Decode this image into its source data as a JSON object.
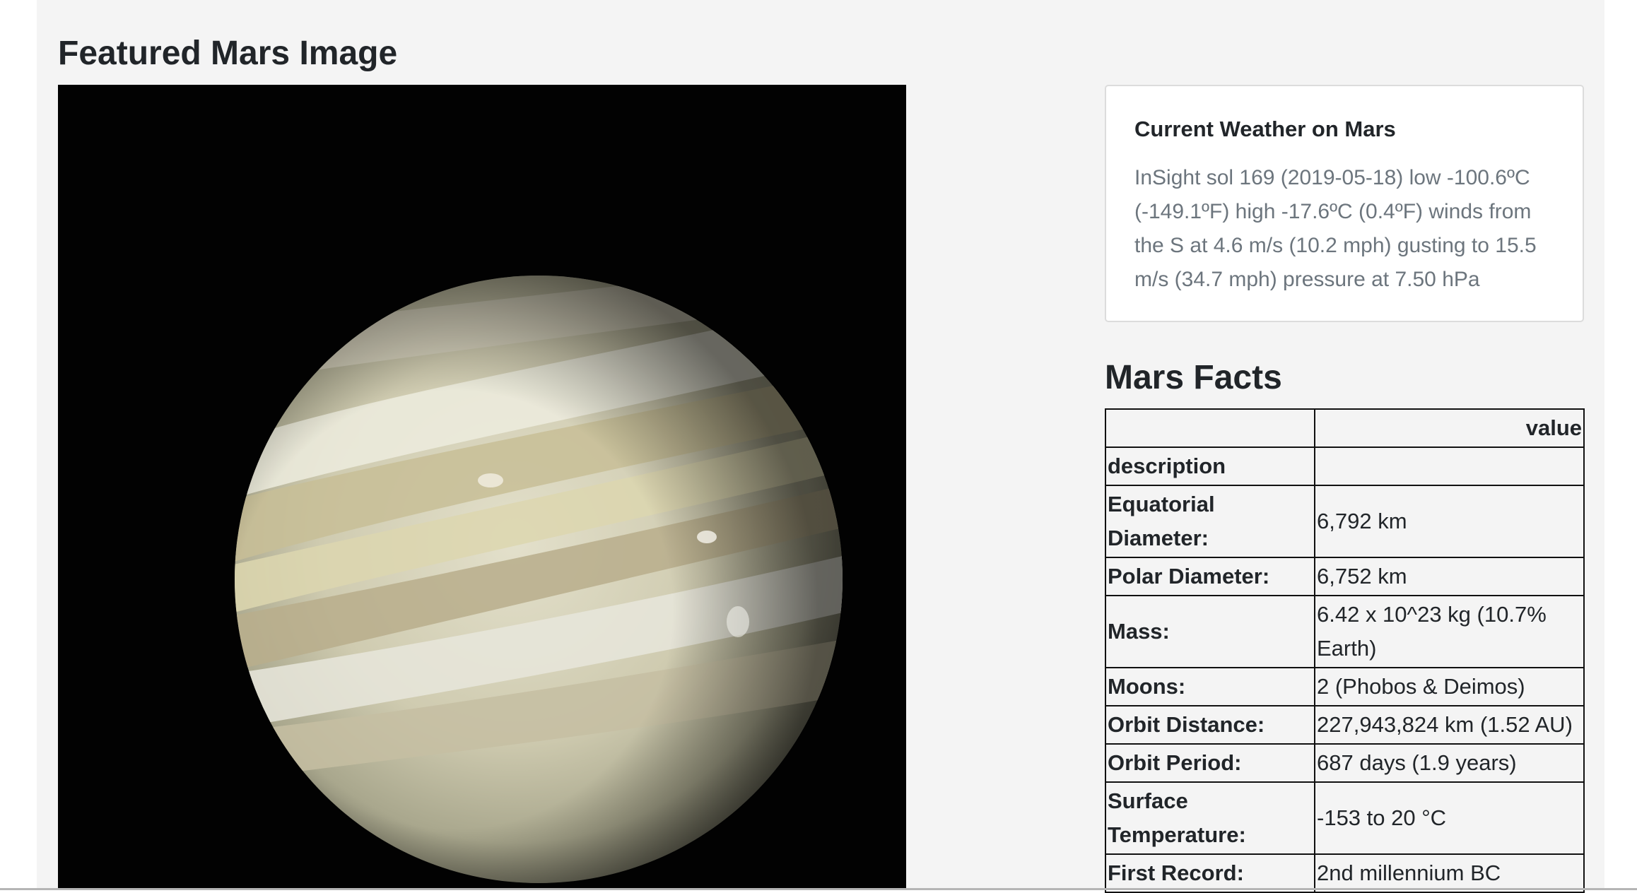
{
  "featured": {
    "title": "Featured Mars Image"
  },
  "weather": {
    "title": "Current Weather on Mars",
    "text": "InSight sol 169 (2019-05-18) low -100.6ºC (-149.1ºF) high -17.6ºC (0.4ºF) winds from the S at 4.6 m/s (10.2 mph) gusting to 15.5 m/s (34.7 mph) pressure at 7.50 hPa"
  },
  "facts": {
    "title": "Mars Facts",
    "column_header": "value",
    "index_header": "description",
    "rows": [
      {
        "label": "Equatorial Diameter:",
        "value": "6,792 km"
      },
      {
        "label": "Polar Diameter:",
        "value": "6,752 km"
      },
      {
        "label": "Mass:",
        "value": "6.42 x 10^23 kg (10.7% Earth)"
      },
      {
        "label": "Moons:",
        "value": "2 (Phobos & Deimos)"
      },
      {
        "label": "Orbit Distance:",
        "value": "227,943,824 km (1.52 AU)"
      },
      {
        "label": "Orbit Period:",
        "value": "687 days (1.9 years)"
      },
      {
        "label": "Surface Temperature:",
        "value": "-153 to 20 °C"
      },
      {
        "label": "First Record:",
        "value": "2nd millennium BC"
      }
    ]
  },
  "colors": {
    "page_background": "#f4f4f4",
    "card_background": "#ffffff",
    "muted_text": "#6c757d"
  }
}
